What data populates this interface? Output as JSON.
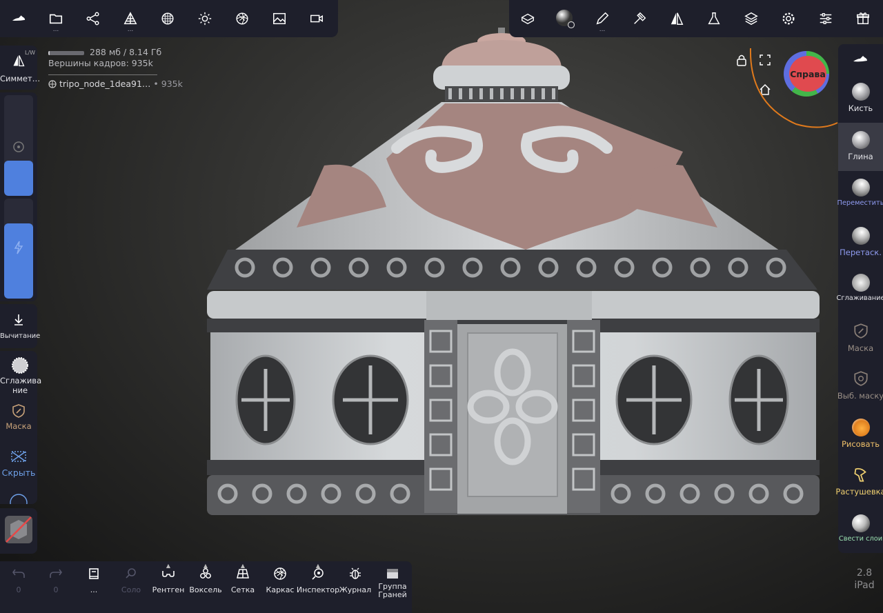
{
  "top_left": {
    "buttons": [
      {
        "name": "app-logo-icon",
        "dots": false
      },
      {
        "name": "folder-icon",
        "dots": true
      },
      {
        "name": "scene-graph-icon",
        "dots": false
      },
      {
        "name": "layers-stack-icon",
        "dots": true
      },
      {
        "name": "sphere-grid-icon",
        "dots": false
      },
      {
        "name": "light-icon",
        "dots": false
      },
      {
        "name": "material-icon",
        "dots": false
      },
      {
        "name": "image-icon",
        "dots": false
      },
      {
        "name": "video-icon",
        "dots": false
      }
    ],
    "dots": "..."
  },
  "stats": {
    "memory": "288 мб / 8.14 Гб",
    "memory_fraction": 0.035,
    "vertices": "Вершины кадров:  935k",
    "node_name": "tripo_node_1dea91…",
    "node_count": "• 935k"
  },
  "left": {
    "symmetry_label": "Симмет…",
    "symmetry_badge": "L/W",
    "radius_fraction": 0.35,
    "intensity_fraction": 0.75,
    "subtract_label": "Вычитание",
    "tools": [
      "Сглажива\nние",
      "Маска",
      "Скрыть"
    ]
  },
  "viewport": {
    "gizmo_label": "Справа"
  },
  "right_tools": [
    {
      "label": "Кисть",
      "color": "#e4e4e8",
      "small": false
    },
    {
      "label": "Глина",
      "color": "#e4e4e8",
      "small": false,
      "selected": true
    },
    {
      "label": "Переместить",
      "color": "#8f9bf0",
      "small": true
    },
    {
      "label": "Перетаск.",
      "color": "#8f9bf0",
      "small": false
    },
    {
      "label": "Сглаживание",
      "color": "#e4e4e8",
      "small": true
    },
    {
      "label": "Маска",
      "color": "#9a8f86",
      "small": false
    },
    {
      "label": "Выб. маску",
      "color": "#9a8f86",
      "small": false
    },
    {
      "label": "Рисовать",
      "color": "#f0c06a",
      "small": false
    },
    {
      "label": "Растушевка",
      "color": "#f0d070",
      "small": false
    },
    {
      "label": "Свести слои",
      "color": "#9ae0b0",
      "small": true
    }
  ],
  "bottom": {
    "undo_count": "0",
    "redo_count": "0",
    "solo_label": "Соло",
    "dots": "...",
    "xray_label": "Рентген",
    "voxel_label": "Воксель",
    "grid_label": "Сетка",
    "wire_label": "Каркас",
    "inspector_label": "Инспектор",
    "journal_label": "Журнал",
    "facegroup_label": "Группа\nГраней"
  },
  "version": {
    "number": "2.8",
    "device": "iPad"
  },
  "colors": {
    "panel": "#1e1f2b",
    "accent_blue": "#4f80de",
    "gizmo_orange": "#e07a1c"
  }
}
